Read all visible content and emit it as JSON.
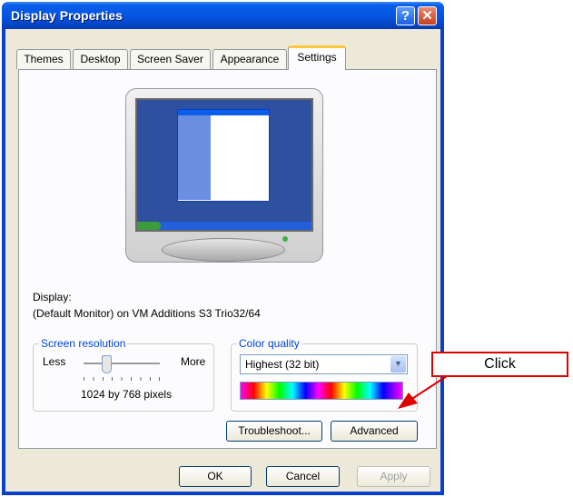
{
  "window": {
    "title": "Display Properties",
    "help_glyph": "?",
    "close_glyph": "✕"
  },
  "tabs": [
    {
      "label": "Themes"
    },
    {
      "label": "Desktop"
    },
    {
      "label": "Screen Saver"
    },
    {
      "label": "Appearance"
    },
    {
      "label": "Settings",
      "active": true
    }
  ],
  "display": {
    "label": "Display:",
    "value": "(Default Monitor) on VM Additions S3 Trio32/64"
  },
  "resolution": {
    "legend": "Screen resolution",
    "less": "Less",
    "more": "More",
    "value": "1024 by 768 pixels",
    "slider_level": 0.3
  },
  "color_quality": {
    "legend": "Color quality",
    "selected": "Highest (32 bit)"
  },
  "buttons": {
    "troubleshoot": "Troubleshoot...",
    "advanced": "Advanced",
    "ok": "OK",
    "cancel": "Cancel",
    "apply": "Apply"
  },
  "annotation": {
    "callout": "Click",
    "color": "#e00000"
  },
  "colors": {
    "titlebar": "#0456e2",
    "client": "#ece9d8",
    "group_legend": "#0046d5"
  }
}
